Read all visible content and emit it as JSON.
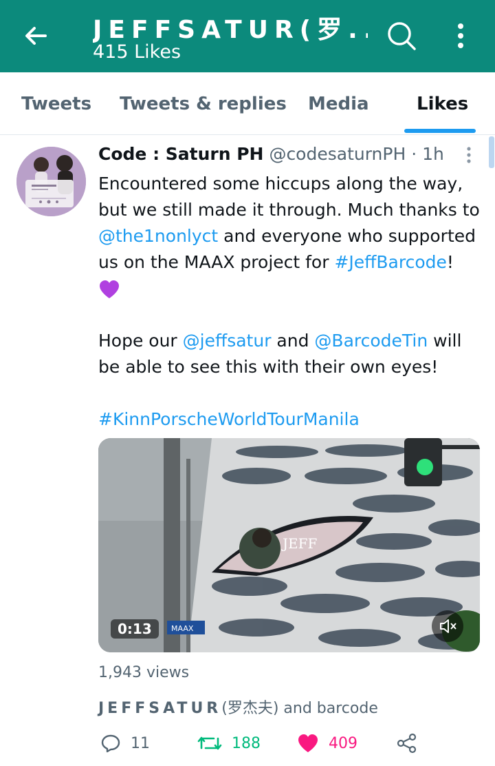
{
  "header": {
    "title": "JEFFSATUR(罗...",
    "subtitle": "415 Likes"
  },
  "tabs": [
    {
      "label": "Tweets",
      "active": false
    },
    {
      "label": "Tweets & replies",
      "active": false
    },
    {
      "label": "Media",
      "active": false
    },
    {
      "label": "Likes",
      "active": true
    }
  ],
  "tweet": {
    "author_name": "Code : Saturn PH",
    "author_handle": "@codesaturnPH",
    "separator": "·",
    "time": "1h",
    "paragraph1": {
      "part1": "Encountered some hiccups along the way, but we still made it through. Much thanks to ",
      "mention1": "@the1nonlyct",
      "part2": " and everyone who supported us on the MAAX project for ",
      "hashtag1": "#JeffBarcode",
      "part3": "!"
    },
    "paragraph2": {
      "part1": "Hope our ",
      "mention1": "@jeffsatur",
      "part2": " and ",
      "mention2": "@BarcodeTin",
      "part3": " will be able to see this with their own eyes!"
    },
    "hashtag2": "#KinnPorscheWorldTourManila",
    "video": {
      "duration": "0:13",
      "billboard_text": "JEFF",
      "sign_text": "MAAX"
    },
    "views": "1,943 views",
    "liked_by": {
      "name": "JEFFSATUR",
      "name_cn": "(罗杰夫)",
      "suffix": " and barcode"
    },
    "stats": {
      "replies": "11",
      "retweets": "188",
      "likes": "409"
    }
  },
  "colors": {
    "header_bg": "#0c8a7c",
    "link": "#1d9bf0",
    "retweet": "#00ba7c",
    "like": "#f91880",
    "muted": "#536471"
  }
}
